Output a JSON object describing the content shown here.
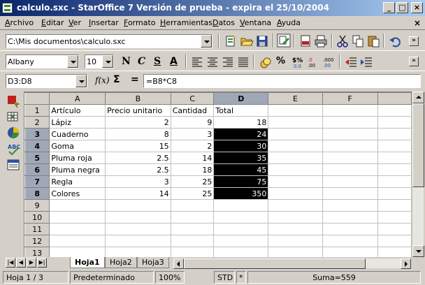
{
  "window": {
    "title": "calculo.sxc - StarOffice 7 Versión de prueba - expira el 25/10/2004"
  },
  "menu": [
    {
      "label": "Archivo",
      "u": "A",
      "rest": "rchivo"
    },
    {
      "label": "Editar",
      "u": "E",
      "rest": "ditar"
    },
    {
      "label": "Ver",
      "u": "V",
      "rest": "er"
    },
    {
      "label": "Insertar",
      "u": "I",
      "rest": "nsertar"
    },
    {
      "label": "Formato",
      "u": "F",
      "rest": "ormato"
    },
    {
      "label": "Herramientas",
      "u": "H",
      "rest": "erramientas"
    },
    {
      "label": "Datos",
      "u": "D",
      "rest": "atos"
    },
    {
      "label": "Ventana",
      "u": "V",
      "rest": "entana"
    },
    {
      "label": "Ayuda",
      "u": "A",
      "rest": "yuda"
    }
  ],
  "toolbar": {
    "url": "C:\\Mis documentos\\calculo.sxc"
  },
  "format": {
    "font": "Albany",
    "size": "10",
    "bold": "N",
    "italic": "C",
    "underline": "S",
    "font_color": "A"
  },
  "formula": {
    "cellref": "D3:D8",
    "func_symbol": "f(x)",
    "sum_symbol": "Σ",
    "eq_symbol": "=",
    "value": "=B8*C8"
  },
  "grid": {
    "columns": [
      "A",
      "B",
      "C",
      "D",
      "E",
      "F"
    ],
    "rows": [
      {
        "n": "1",
        "a": "Artículo",
        "b": "Precio unitario",
        "c": "Cantidad",
        "d": "Total"
      },
      {
        "n": "2",
        "a": "Lápiz",
        "b": "2",
        "c": "9",
        "d": "18"
      },
      {
        "n": "3",
        "a": "Cuaderno",
        "b": "8",
        "c": "3",
        "d": "24"
      },
      {
        "n": "4",
        "a": "Goma",
        "b": "15",
        "c": "2",
        "d": "30"
      },
      {
        "n": "5",
        "a": "Pluma roja",
        "b": "2.5",
        "c": "14",
        "d": "35"
      },
      {
        "n": "6",
        "a": "Pluma negra",
        "b": "2.5",
        "c": "18",
        "d": "45"
      },
      {
        "n": "7",
        "a": "Regla",
        "b": "3",
        "c": "25",
        "d": "75"
      },
      {
        "n": "8",
        "a": "Colores",
        "b": "14",
        "c": "25",
        "d": "350"
      },
      {
        "n": "9",
        "a": "",
        "b": "",
        "c": "",
        "d": ""
      },
      {
        "n": "10",
        "a": "",
        "b": "",
        "c": "",
        "d": ""
      },
      {
        "n": "11",
        "a": "",
        "b": "",
        "c": "",
        "d": ""
      },
      {
        "n": "12",
        "a": "",
        "b": "",
        "c": "",
        "d": ""
      },
      {
        "n": "13",
        "a": "",
        "b": "",
        "c": "",
        "d": ""
      }
    ],
    "selected_column": "D",
    "highlighted_rows": [
      "3",
      "4",
      "5",
      "6",
      "7",
      "8"
    ]
  },
  "sheets": [
    "Hoja1",
    "Hoja2",
    "Hoja3"
  ],
  "active_sheet": "Hoja1",
  "status": {
    "page": "Hoja 1 / 3",
    "style": "Predeterminado",
    "zoom": "100%",
    "mode": "STD",
    "modified": "*",
    "sum": "Suma=559"
  }
}
